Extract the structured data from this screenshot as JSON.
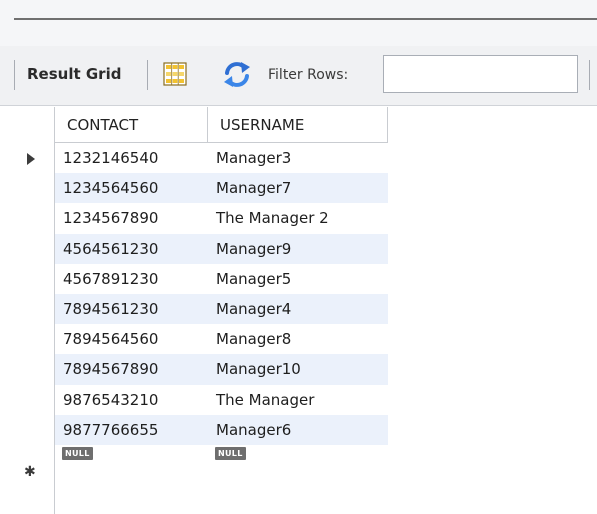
{
  "toolbar": {
    "result_grid_label": "Result Grid",
    "grid_icon": "grid-layout-icon",
    "refresh_icon": "refresh-icon",
    "filter_label": "Filter Rows:",
    "filter_value": ""
  },
  "grid": {
    "columns": [
      {
        "label": "CONTACT"
      },
      {
        "label": "USERNAME"
      }
    ],
    "rows": [
      {
        "contact": "1232146540",
        "username": "Manager3",
        "current": true
      },
      {
        "contact": "1234564560",
        "username": "Manager7"
      },
      {
        "contact": "1234567890",
        "username": "The Manager 2"
      },
      {
        "contact": "4564561230",
        "username": "Manager9"
      },
      {
        "contact": "4567891230",
        "username": "Manager5"
      },
      {
        "contact": "7894561230",
        "username": "Manager4"
      },
      {
        "contact": "7894564560",
        "username": "Manager8"
      },
      {
        "contact": "7894567890",
        "username": "Manager10"
      },
      {
        "contact": "9876543210",
        "username": "The Manager"
      },
      {
        "contact": "9877766655",
        "username": "Manager6"
      }
    ],
    "new_row": {
      "contact": "NULL",
      "username": "NULL",
      "marker": "✱"
    }
  },
  "colors": {
    "alt_row": "#ebf1fb",
    "toolbar_bg": "#f0f1f3",
    "null_badge": "#6e6e6e"
  }
}
